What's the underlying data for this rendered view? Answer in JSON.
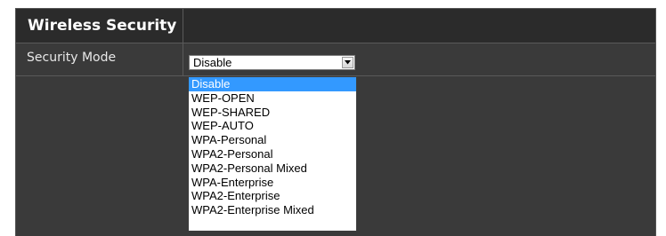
{
  "section": {
    "title": "Wireless Security"
  },
  "security_mode": {
    "label": "Security Mode",
    "selected_value": "Disable",
    "options": [
      "Disable",
      "WEP-OPEN",
      "WEP-SHARED",
      "WEP-AUTO",
      "WPA-Personal",
      "WPA2-Personal",
      "WPA2-Personal Mixed",
      "WPA-Enterprise",
      "WPA2-Enterprise",
      "WPA2-Enterprise Mixed"
    ],
    "highlighted_index": 0
  },
  "colors": {
    "panel_background": "#3a3a3a",
    "title_background": "#2b2b2b",
    "highlight": "#3399ff"
  },
  "icons": {
    "dropdown_arrow": "chevron-down-icon"
  }
}
